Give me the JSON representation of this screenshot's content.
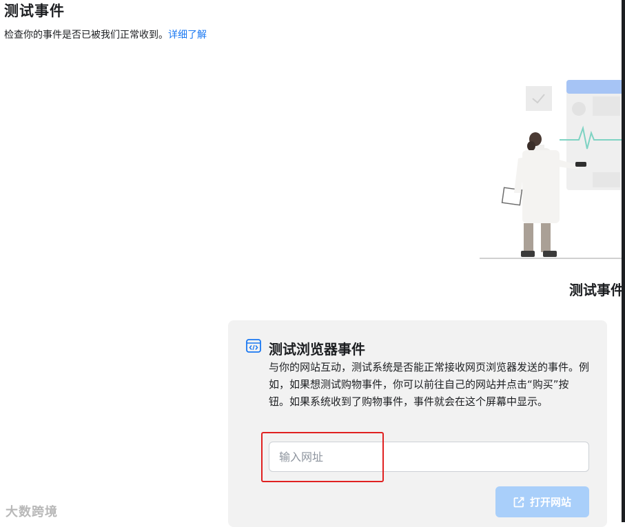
{
  "header": {
    "title": "测试事件",
    "subtitle": "检查你的事件是否已被我们正常收到。",
    "learn_more": "详细了解"
  },
  "section": {
    "title": "测试事件"
  },
  "browser_events_card": {
    "icon": "code-window-icon",
    "title": "测试浏览器事件",
    "description": "与你的网站互动，测试系统是否能正常接收网页浏览器发送的事件。例如，如果想测试购物事件，你可以前往自己的网站并点击“购买”按钮。如果系统收到了购物事件，事件就会在这个屏幕中显示。",
    "url_input": {
      "value": "",
      "placeholder": "输入网址"
    },
    "open_site_button": {
      "icon": "external-link-icon",
      "label": "打开网站"
    }
  },
  "watermark": {
    "text": "大数跨境"
  },
  "colors": {
    "link": "#1877f2",
    "card_bg": "#f2f2f2",
    "button_disabled": "#a9cffa",
    "highlight": "#e02020"
  }
}
